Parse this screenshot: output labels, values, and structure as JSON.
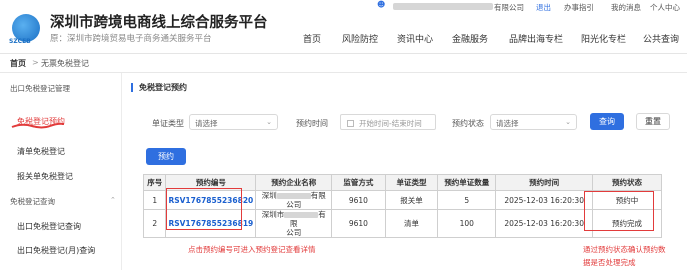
{
  "topbar": {
    "company_suffix": "有限公司",
    "logout": "退出",
    "help": "办事指引",
    "messages": "我的消息",
    "user_center": "个人中心"
  },
  "header": {
    "logo_text": "SZCEB",
    "title": "深圳市跨境电商线上综合服务平台",
    "subtitle": "原：深圳市跨境贸易电子商务通关服务平台",
    "nav": [
      "首页",
      "风险防控",
      "资讯中心",
      "金融服务",
      "品牌出海专栏",
      "阳光化专栏",
      "公共查询"
    ]
  },
  "breadcrumb": {
    "home": "首页",
    "sep": ">",
    "current": "无票免税登记"
  },
  "sidebar": {
    "group1": "出口免税登记管理",
    "items1": [
      "免税登记预约",
      "清单免税登记",
      "报关单免税登记"
    ],
    "group2": "免税登记查询",
    "items2": [
      "出口免税登记查询",
      "出口免税登记(月)查询"
    ]
  },
  "main": {
    "section_title": "免税登记预约",
    "filters": {
      "doc_type_label": "单证类型",
      "doc_type_value": "请选择",
      "time_label": "预约时间",
      "time_placeholder": "开始时间-结束时间",
      "status_label": "预约状态",
      "status_value": "请选择"
    },
    "query_button": "查询",
    "reset_button": "重置",
    "reserve_button": "预约",
    "table": {
      "headers": [
        "序号",
        "预约编号",
        "预约企业名称",
        "监管方式",
        "单证类型",
        "预约单证数量",
        "预约时间",
        "预约状态"
      ],
      "rows": [
        {
          "idx": "1",
          "no": "RSV1767855236820",
          "company_a": "深圳",
          "company_b": "有限",
          "company_c": "公司",
          "mode": "9610",
          "doc": "报关单",
          "count": "5",
          "time": "2025-12-03 16:20:30",
          "status": "预约中"
        },
        {
          "idx": "2",
          "no": "RSV1767855236819",
          "company_a": "深圳市",
          "company_b": "有限",
          "company_c": "公司",
          "mode": "9610",
          "doc": "清单",
          "count": "100",
          "time": "2025-12-03 16:20:30",
          "status": "预约完成"
        }
      ]
    },
    "note_left": "点击预约编号可进入预约登记查看详情",
    "note_right_1": "通过预约状态确认预约数",
    "note_right_2": "据是否处理完成"
  },
  "colors": {
    "accent": "#2f6fe0",
    "annotation": "#e23b3b",
    "link": "#1a5fcf"
  }
}
